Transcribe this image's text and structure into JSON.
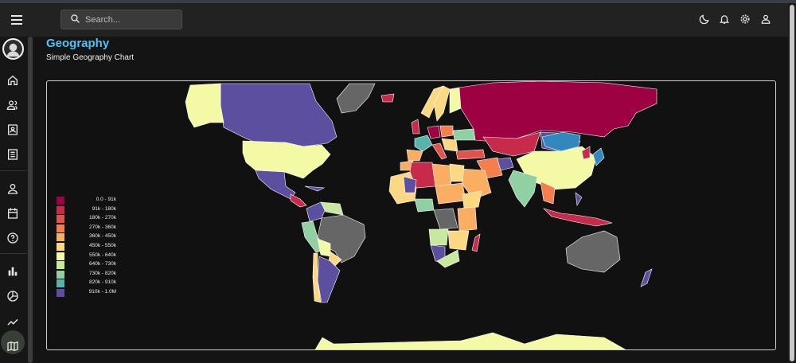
{
  "header": {
    "search_placeholder": "Search...",
    "icons": [
      "menu-icon",
      "search-icon",
      "moon-icon",
      "bell-icon",
      "gear-icon",
      "user-icon"
    ]
  },
  "sidebar": {
    "items": [
      {
        "icon": "home-icon"
      },
      {
        "icon": "people-icon"
      },
      {
        "icon": "contact-card-icon"
      },
      {
        "icon": "receipt-icon"
      },
      {
        "icon": "person-icon"
      },
      {
        "icon": "calendar-icon"
      },
      {
        "icon": "help-icon"
      },
      {
        "icon": "bar-chart-icon"
      },
      {
        "icon": "pie-chart-icon"
      },
      {
        "icon": "line-chart-icon"
      },
      {
        "icon": "map-icon"
      }
    ]
  },
  "main": {
    "title": "Geography",
    "subtitle": "Simple Geography Chart"
  },
  "chart_data": {
    "type": "choropleth",
    "title": "",
    "legend_position": "left",
    "legend": [
      {
        "label": "0.0 - 91k",
        "color": "#9e0142"
      },
      {
        "label": "91k - 180k",
        "color": "#c72a4a"
      },
      {
        "label": "180k - 270k",
        "color": "#e25349"
      },
      {
        "label": "270k - 360k",
        "color": "#f47e4c"
      },
      {
        "label": "360k - 450k",
        "color": "#fbad62"
      },
      {
        "label": "450k - 550k",
        "color": "#fdd882"
      },
      {
        "label": "550k - 640k",
        "color": "#f4f9a6"
      },
      {
        "label": "640k - 730k",
        "color": "#c7e89e"
      },
      {
        "label": "730k - 820k",
        "color": "#91d0a3"
      },
      {
        "label": "820k - 910k",
        "color": "#58b4ab"
      },
      {
        "label": "910k - 1.0M",
        "color": "#5c4fa0"
      }
    ],
    "no_data_color": "#666666"
  }
}
